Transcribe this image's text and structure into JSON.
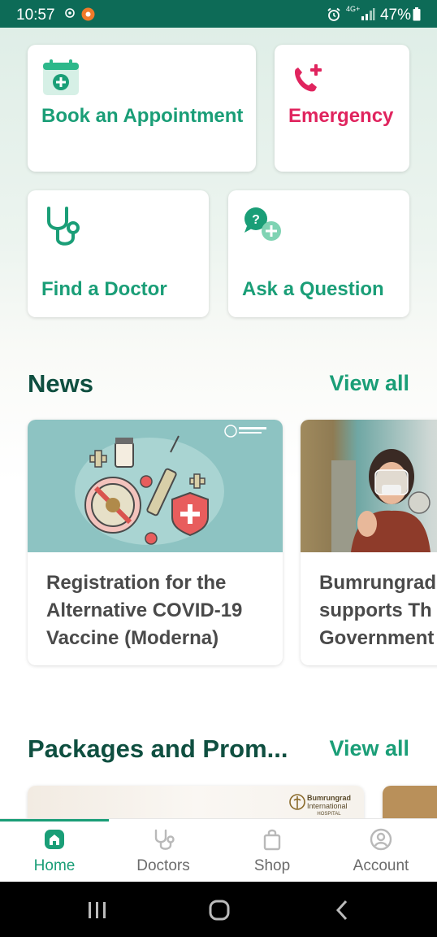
{
  "status_bar": {
    "time": "10:57",
    "battery": "47%",
    "network": "4G+"
  },
  "quick_actions": {
    "book": "Book an Appointment",
    "emergency": "Emergency",
    "find_doctor": "Find a Doctor",
    "ask_question": "Ask a Question"
  },
  "news": {
    "title": "News",
    "view_all": "View all",
    "items": [
      {
        "title_lines": [
          "Registration for the",
          "Alternative COVID-19",
          "Vaccine (Moderna)"
        ]
      },
      {
        "title_lines": [
          "Bumrungrad",
          "supports Th",
          "Government"
        ]
      }
    ]
  },
  "packages": {
    "title": "Packages and Prom...",
    "view_all": "View all",
    "hospital_logo_text": [
      "Bumrungrad",
      "International",
      "HOSPITAL"
    ]
  },
  "bottom_nav": {
    "items": [
      {
        "label": "Home",
        "icon": "home-icon",
        "active": true
      },
      {
        "label": "Doctors",
        "icon": "stethoscope-icon",
        "active": false
      },
      {
        "label": "Shop",
        "icon": "shopping-bag-icon",
        "active": false
      },
      {
        "label": "Account",
        "icon": "account-icon",
        "active": false
      }
    ]
  },
  "colors": {
    "accent": "#1a9e77",
    "emergency": "#e0245e",
    "status_bar": "#0d6b57",
    "heading": "#0f4f40"
  }
}
